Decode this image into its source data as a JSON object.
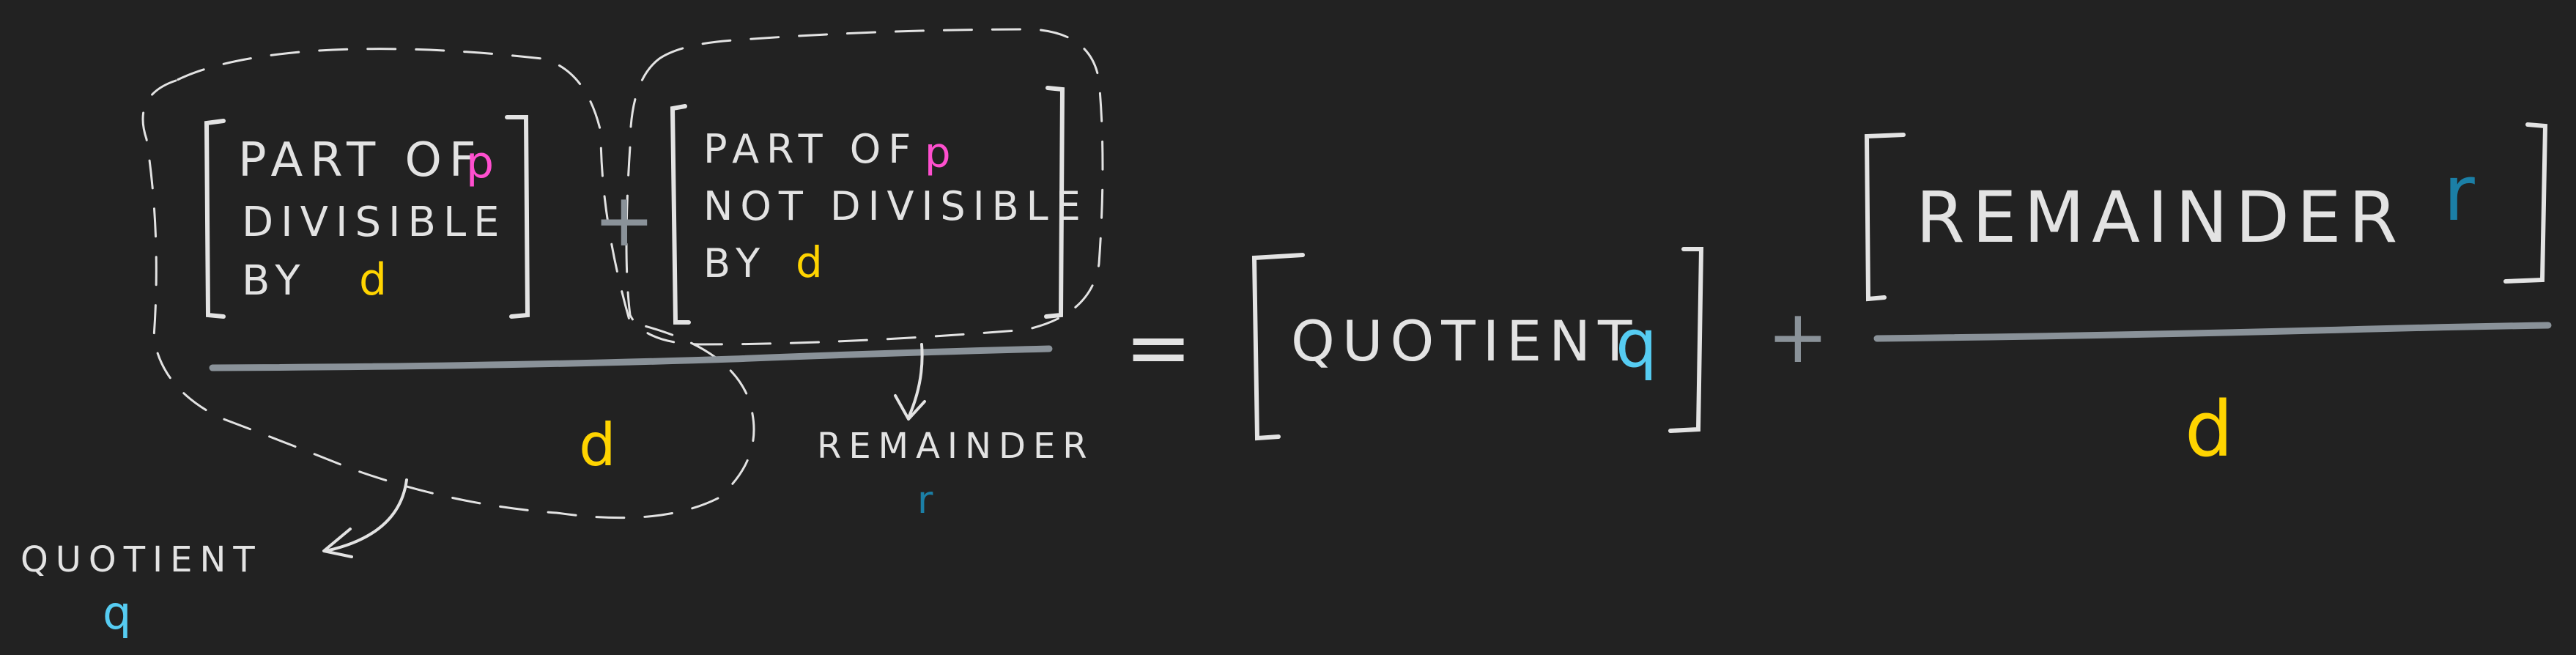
{
  "left_box": {
    "line1": "PART OF",
    "line1_var": "p",
    "line2": "DIVISIBLE",
    "line3": "BY",
    "line3_var": "d"
  },
  "middle_box": {
    "line1": "PART OF",
    "line1_var": "p",
    "line2": "NOT DIVISIBLE",
    "line3": "BY",
    "line3_var": "d"
  },
  "plus_left": "+",
  "left_denominator": "d",
  "remainder_annotation": {
    "label": "REMAINDER",
    "var": "r"
  },
  "quotient_annotation": {
    "label": "QUOTIENT",
    "var": "q"
  },
  "equals": "=",
  "rhs": {
    "quotient_label": "QUOTIENT",
    "quotient_var": "q",
    "plus": "+",
    "remainder_label": "REMAINDER",
    "remainder_var": "r",
    "denominator": "d"
  },
  "colors": {
    "background": "#222222",
    "chalk": "#e3e3e3",
    "p_color": "#ff4fcf",
    "d_color": "#ffd400",
    "q_color": "#56ccf2",
    "r_color": "#1b7fa6",
    "fraction_bar": "#8a9299"
  }
}
